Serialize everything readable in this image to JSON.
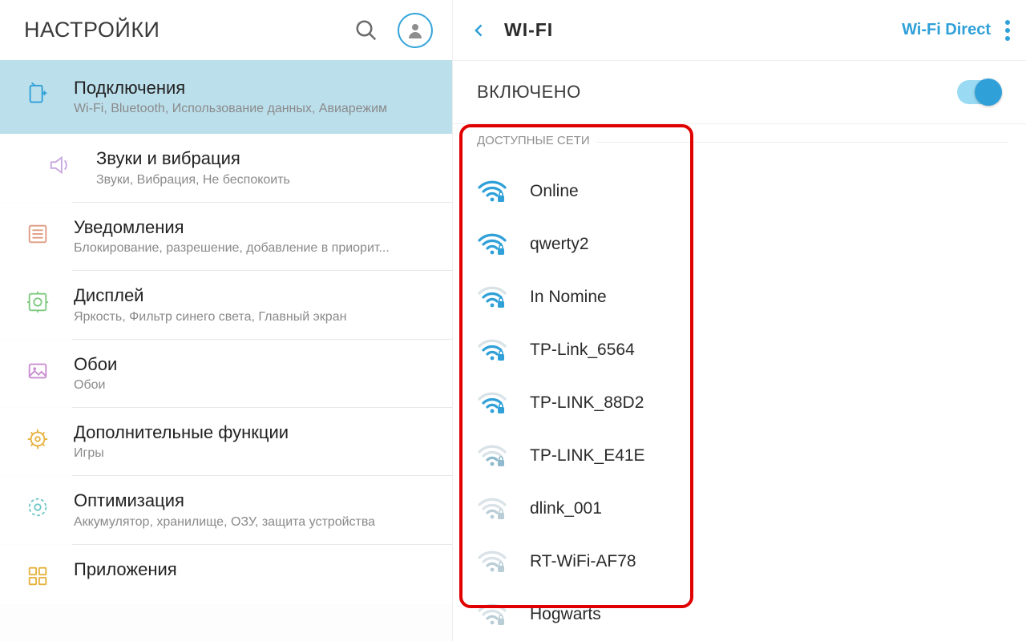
{
  "left": {
    "title": "НАСТРОЙКИ",
    "categories": [
      {
        "icon": "connections",
        "title": "Подключения",
        "sub": "Wi-Fi, Bluetooth, Использование данных, Авиарежим",
        "selected": true,
        "color_a": "#2fa0d8",
        "color_b": "#2fa0d8"
      },
      {
        "icon": "sound",
        "title": "Звуки и вибрация",
        "sub": "Звуки, Вибрация, Не беспокоить",
        "color_a": "#c6a7e0",
        "color_b": "#c6a7e0"
      },
      {
        "icon": "notifications",
        "title": "Уведомления",
        "sub": "Блокирование, разрешение, добавление в приорит...",
        "color_a": "#e09a82",
        "color_b": "#e09a82"
      },
      {
        "icon": "display",
        "title": "Дисплей",
        "sub": "Яркость, Фильтр синего света, Главный экран",
        "color_a": "#7fc97f",
        "color_b": "#7fc97f"
      },
      {
        "icon": "wallpaper",
        "title": "Обои",
        "sub": "Обои",
        "color_a": "#c98dd1",
        "color_b": "#c98dd1"
      },
      {
        "icon": "advanced",
        "title": "Дополнительные функции",
        "sub": "Игры",
        "color_a": "#e6b23f",
        "color_b": "#e6b23f"
      },
      {
        "icon": "optimize",
        "title": "Оптимизация",
        "sub": "Аккумулятор, хранилище, ОЗУ, защита устройства",
        "color_a": "#73c8c8",
        "color_b": "#73c8c8"
      },
      {
        "icon": "apps",
        "title": "Приложения",
        "sub": "",
        "color_a": "#e6b23f",
        "color_b": "#e6b23f"
      }
    ]
  },
  "right": {
    "title": "WI-FI",
    "wifi_direct": "Wi-Fi Direct",
    "toggle_label": "ВКЛЮЧЕНО",
    "toggle_on": true,
    "section_label": "ДОСТУПНЫЕ СЕТИ",
    "networks": [
      {
        "ssid": "Online",
        "signal": 3,
        "secured": true,
        "color": "#2fa0d8"
      },
      {
        "ssid": "qwerty2",
        "signal": 3,
        "secured": true,
        "color": "#2fa0d8"
      },
      {
        "ssid": "In Nomine",
        "signal": 2,
        "secured": true,
        "color": "#2fa0d8"
      },
      {
        "ssid": "TP-Link_6564",
        "signal": 2,
        "secured": true,
        "color": "#2fa0d8"
      },
      {
        "ssid": "TP-LINK_88D2",
        "signal": 2,
        "secured": true,
        "color": "#2fa0d8"
      },
      {
        "ssid": "TP-LINK_E41E",
        "signal": 1,
        "secured": true,
        "color": "#8fb9cc"
      },
      {
        "ssid": "dlink_001",
        "signal": 1,
        "secured": true,
        "color": "#b9cdd6"
      },
      {
        "ssid": "RT-WiFi-AF78",
        "signal": 1,
        "secured": true,
        "color": "#b9cdd6"
      },
      {
        "ssid": "Hogwarts",
        "signal": 1,
        "secured": true,
        "color": "#b9cdd6"
      }
    ]
  }
}
